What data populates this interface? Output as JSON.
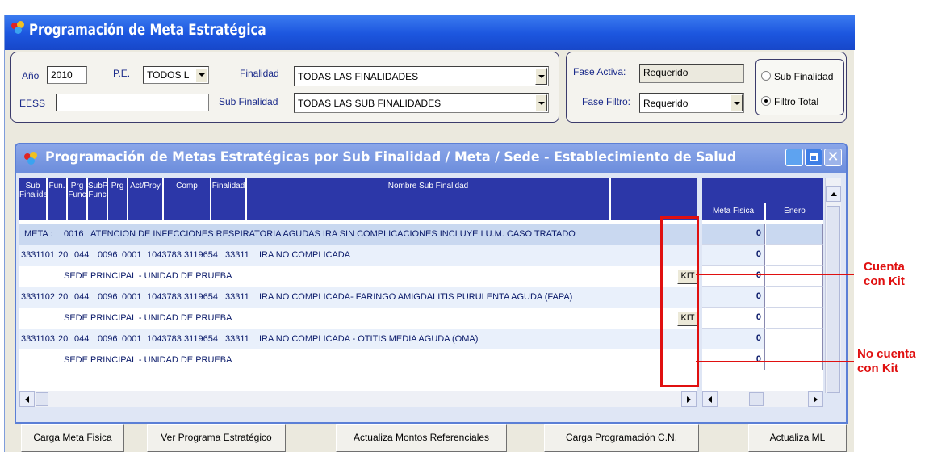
{
  "window": {
    "title": "Programación de Meta Estratégica"
  },
  "filters": {
    "anio_label": "Año",
    "anio_value": "2010",
    "pe_label": "P.E.",
    "pe_value": "TODOS L",
    "finalidad_label": "Finalidad",
    "finalidad_value": "TODAS LAS FINALIDADES",
    "eess_label": "EESS",
    "eess_value": "",
    "subfinalidad_label": "Sub Finalidad",
    "subfinalidad_value": "TODAS LAS SUB FINALIDADES",
    "fase_activa_label": "Fase Activa:",
    "fase_activa_value": "Requerido",
    "fase_filtro_label": "Fase Filtro:",
    "fase_filtro_value": "Requerido",
    "radio_sub_finalidad": "Sub Finalidad",
    "radio_filtro_total": "Filtro Total",
    "radio_selected": "Filtro Total"
  },
  "child_window": {
    "title": "Programación de Metas Estratégicas por Sub Finalidad / Meta / Sede - Establecimiento de Salud"
  },
  "grid": {
    "headers": [
      "Sub Finalidad",
      "Fun.",
      "Prg Func",
      "SubP Func",
      "Prg",
      "Act/Proy",
      "Comp",
      "Finalidad",
      "Nombre Sub Finalidad"
    ],
    "meta_row": {
      "label": "META :",
      "code": "0016",
      "description": "ATENCION DE INFECCIONES RESPIRATORIA AGUDAS IRA SIN COMPLICACIONES INCLUYE I U.M. CASO TRATADO"
    },
    "rows": [
      {
        "sub": "3331101",
        "fun": "20",
        "prg": "044",
        "subp": "0096",
        "prg2": "0001",
        "act": "1043783",
        "comp": "3119654",
        "fin": "33311",
        "name": "IRA NO COMPLICADA"
      },
      {
        "sede": "SEDE PRINCIPAL - UNIDAD DE PRUEBA",
        "kit": "KIT"
      },
      {
        "sub": "3331102",
        "fun": "20",
        "prg": "044",
        "subp": "0096",
        "prg2": "0001",
        "act": "1043783",
        "comp": "3119654",
        "fin": "33311",
        "name": "IRA NO COMPLICADA- FARINGO AMIGDALITIS PURULENTA AGUDA (FAPA)"
      },
      {
        "sede": "SEDE PRINCIPAL - UNIDAD DE PRUEBA",
        "kit": "KIT"
      },
      {
        "sub": "3331103",
        "fun": "20",
        "prg": "044",
        "subp": "0096",
        "prg2": "0001",
        "act": "1043783",
        "comp": "3119654",
        "fin": "33311",
        "name": "IRA NO COMPLICADA - OTITIS MEDIA AGUDA (OMA)"
      },
      {
        "sede": "SEDE PRINCIPAL - UNIDAD DE PRUEBA"
      }
    ]
  },
  "right_grid": {
    "headers": [
      "Meta Fisica",
      "Enero"
    ],
    "values": [
      "0",
      "0",
      "0",
      "0",
      "0",
      "0",
      "0"
    ]
  },
  "buttons": {
    "carga_meta": "Carga Meta Fisica",
    "ver_programa": "Ver Programa Estratégico",
    "actualiza_montos": "Actualiza Montos Referenciales",
    "carga_programacion": "Carga Programación C.N.",
    "actualiza_ml": "Actualiza ML"
  },
  "annotations": {
    "cuenta_con_kit": [
      "Cuenta",
      "con Kit"
    ],
    "no_cuenta_con_kit": [
      "No cuenta",
      "con Kit"
    ],
    "color": "#e01010"
  },
  "colors": {
    "title_blue": "#1c56df",
    "header_navy": "#2c37a8",
    "row_text": "#0a1a6a"
  }
}
